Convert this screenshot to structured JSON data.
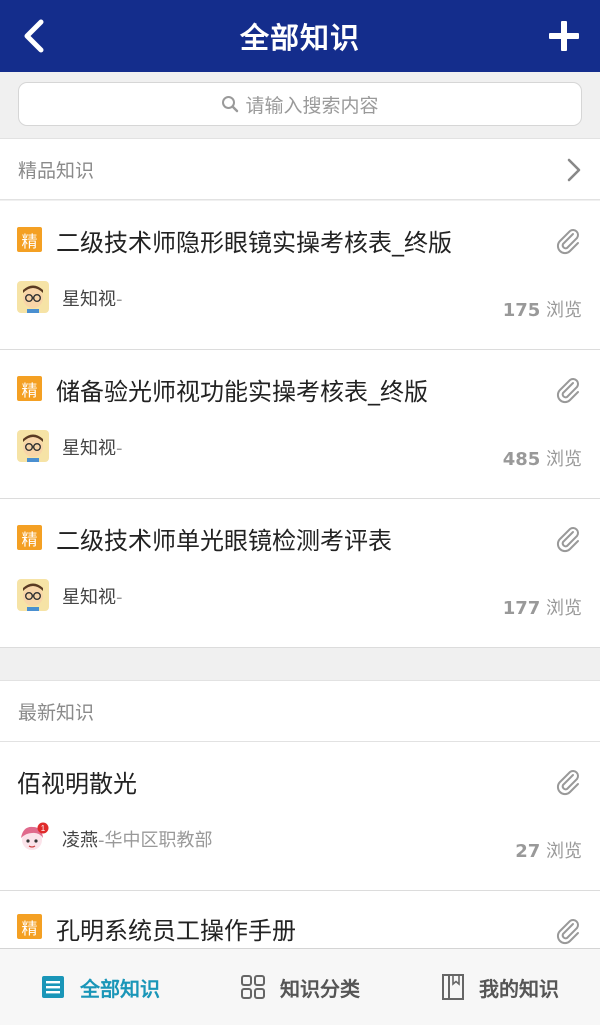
{
  "header": {
    "title": "全部知识"
  },
  "search": {
    "placeholder": "请输入搜索内容"
  },
  "featured": {
    "label": "精品知识",
    "items": [
      {
        "badge": "精",
        "title": "二级技术师隐形眼镜实操考核表_终版",
        "author": "星知视",
        "dept": "-",
        "views": "175",
        "views_unit": "浏览"
      },
      {
        "badge": "精",
        "title": "储备验光师视功能实操考核表_终版",
        "author": "星知视",
        "dept": "-",
        "views": "485",
        "views_unit": "浏览"
      },
      {
        "badge": "精",
        "title": "二级技术师单光眼镜检测考评表",
        "author": "星知视",
        "dept": "-",
        "views": "177",
        "views_unit": "浏览"
      }
    ]
  },
  "latest": {
    "label": "最新知识",
    "items": [
      {
        "title": "佰视明散光",
        "author": "凌燕",
        "dept": "-华中区职教部",
        "views": "27",
        "views_unit": "浏览",
        "avatar_badge": "1"
      },
      {
        "badge": "精",
        "title": "孔明系统员工操作手册"
      }
    ]
  },
  "tabbar": {
    "tabs": [
      {
        "label": "全部知识",
        "icon": "list-icon"
      },
      {
        "label": "知识分类",
        "icon": "grid-icon"
      },
      {
        "label": "我的知识",
        "icon": "book-icon"
      }
    ]
  },
  "colors": {
    "header": "#142d8c",
    "badge": "#f4a023",
    "active_tab": "#1a96b8"
  }
}
